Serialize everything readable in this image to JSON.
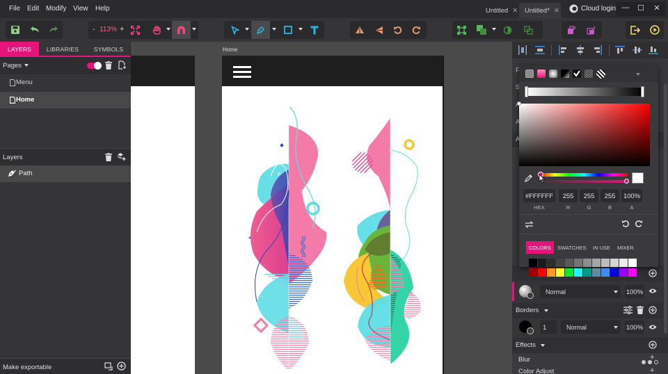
{
  "menu": [
    "File",
    "Edit",
    "Modify",
    "View",
    "Help"
  ],
  "doc_tabs": [
    {
      "label": "Untitled",
      "active": false
    },
    {
      "label": "Untitled*",
      "active": true
    }
  ],
  "cloud_login": "Cloud login",
  "window_controls": {
    "minimize": "—",
    "maximize": "☐",
    "close": "✕"
  },
  "toolbar": {
    "zoom_minus": "-",
    "zoom_level": "113%",
    "zoom_plus": "+"
  },
  "left_panel": {
    "tabs": [
      "LAYERS",
      "LIBRARIES",
      "SYMBOLS"
    ],
    "active_tab": "LAYERS",
    "pages_label": "Pages",
    "pages": [
      {
        "name": "Menu",
        "selected": false
      },
      {
        "name": "Home",
        "selected": true
      }
    ],
    "layers_label": "Layers",
    "layers": [
      {
        "name": "Path",
        "type": "path"
      }
    ],
    "make_exportable": "Make exportable"
  },
  "canvas": {
    "artboard_label": "Home"
  },
  "color_picker": {
    "hex": "#FFFFFF",
    "r": "255",
    "g": "255",
    "b": "255",
    "a": "100%",
    "labels": {
      "hex": "HEX",
      "r": "R",
      "g": "G",
      "b": "B",
      "a": "A"
    },
    "tabs": [
      "COLORS",
      "SWATCHES",
      "IN USE",
      "MIXER"
    ],
    "active_tab": "COLORS",
    "grays": [
      "#000000",
      "#1a1a1a",
      "#2e2e2e",
      "#444444",
      "#5a5a5a",
      "#747474",
      "#8e8e8e",
      "#a6a6a6",
      "#bdbdbd",
      "#d4d4d4",
      "#ebebeb",
      "#ffffff"
    ],
    "colors": [
      "#a00000",
      "#ff0000",
      "#ff9a1f",
      "#ffff2a",
      "#00e639",
      "#1ff5f5",
      "#00998a",
      "#5a8ea3",
      "#3f8cf0",
      "#0000e6",
      "#9b00f0",
      "#ff00ff"
    ]
  },
  "fill": {
    "blend": "Normal",
    "opacity": "100%"
  },
  "borders": {
    "label": "Borders",
    "width": "1",
    "blend": "Normal",
    "opacity": "100%"
  },
  "effects": {
    "label": "Effects",
    "items": [
      "Blur",
      "Color Adjust"
    ]
  },
  "colors": {
    "accent": "#e8137a",
    "cyan_tool": "#29b6e8"
  }
}
